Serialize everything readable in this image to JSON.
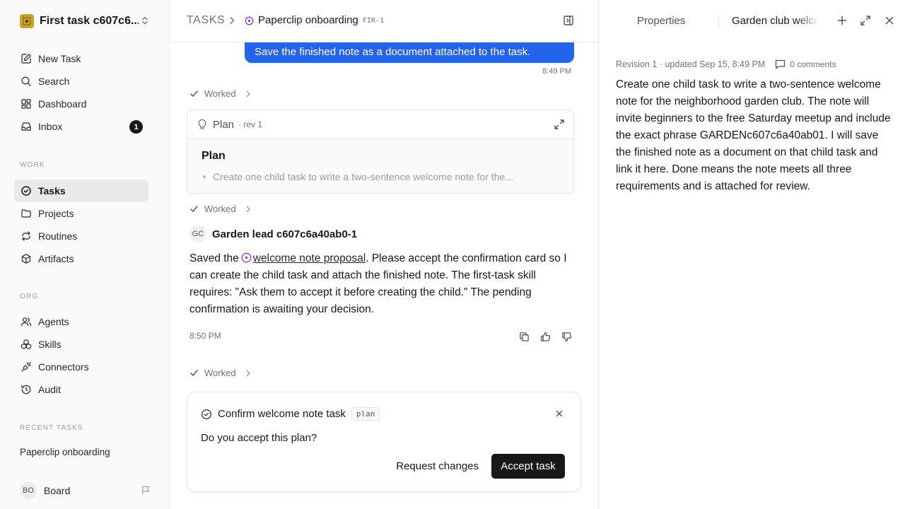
{
  "workspace": {
    "name": "First task c607c6..."
  },
  "nav": {
    "new_task": "New Task",
    "search": "Search",
    "dashboard": "Dashboard",
    "inbox": "Inbox",
    "inbox_count": "1"
  },
  "sections": {
    "work": "WORK",
    "org": "ORG",
    "recent": "RECENT TASKS"
  },
  "work_items": {
    "tasks": "Tasks",
    "projects": "Projects",
    "routines": "Routines",
    "artifacts": "Artifacts"
  },
  "org_items": {
    "agents": "Agents",
    "skills": "Skills",
    "connectors": "Connectors",
    "audit": "Audit"
  },
  "recent_tasks": [
    "Paperclip onboarding"
  ],
  "footer": {
    "avatar": "BO",
    "label": "Board"
  },
  "breadcrumb": {
    "root": "TASKS",
    "title": "Paperclip onboarding",
    "id": "FIR-1"
  },
  "thread": {
    "user_message": "Save the finished note as a document attached to the task.",
    "user_time": "8:49 PM",
    "worked_label": "Worked",
    "plan": {
      "header": "Plan",
      "rev": "· rev 1",
      "title": "Plan",
      "bullet": "Create one child task to write a two-sentence welcome note for the..."
    },
    "author": {
      "initials": "GC",
      "name": "Garden lead c607c6a40ab0-1"
    },
    "reply": {
      "before_link": "Saved the",
      "link": "welcome note proposal",
      "after_link": ". Please accept the confirmation card so I can create the child task and attach the finished note. The first-task skill requires: \"Ask them to accept it before creating the child.\" The pending confirmation is awaiting your decision."
    },
    "reply_time": "8:50 PM"
  },
  "confirm": {
    "title": "Confirm welcome note task",
    "tag": "plan",
    "question": "Do you accept this plan?",
    "request_changes": "Request changes",
    "accept": "Accept task"
  },
  "right_panel": {
    "tab_properties": "Properties",
    "tab_document": "Garden club welcome note",
    "revision": "Revision 1 · updated Sep 15, 8:49 PM",
    "comments": "0 comments",
    "body": "Create one child task to write a two-sentence welcome note for the neighborhood garden club. The note will invite beginners to the free Saturday meetup and include the exact phrase GARDENc607c6a40ab01. I will save the finished note as a document on that child task and link it here. Done means the note meets all three requirements and is attached for review."
  },
  "colors": {
    "accent": "#2563eb",
    "status_purple": "#9333ea",
    "primary_button": "#18181b",
    "logo": "#c9a227"
  }
}
